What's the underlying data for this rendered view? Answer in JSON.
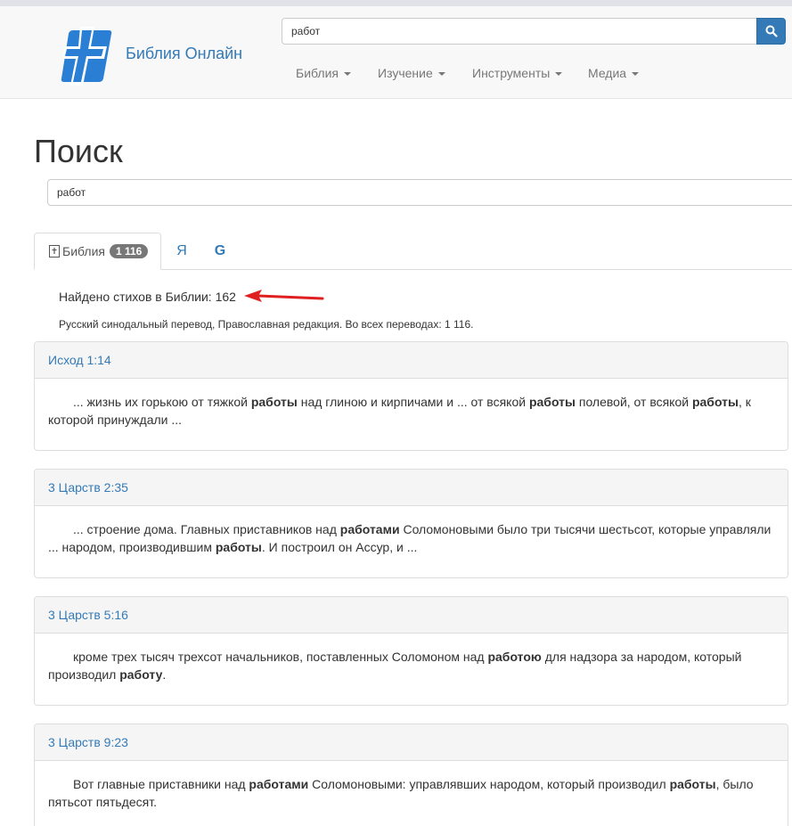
{
  "header": {
    "brand": "Библия Онлайн",
    "search_value": "работ",
    "menu": [
      {
        "label": "Библия"
      },
      {
        "label": "Изучение"
      },
      {
        "label": "Инструменты"
      },
      {
        "label": "Медиа"
      }
    ],
    "accent_color": "#337ab7"
  },
  "page": {
    "title": "Поиск",
    "search_value": "работ"
  },
  "tabs": {
    "bible_label": "Библия",
    "bible_count": "1 116",
    "yandex_label": "Я",
    "google_label": "G"
  },
  "results": {
    "found_text": "Найдено стихов в Библии: 162",
    "translation_note": "Русский синодальный перевод, Православная редакция. Во всех переводах: 1 116.",
    "items": [
      {
        "ref": "Исход 1:14",
        "parts": [
          {
            "t": "... жизнь их горькою от тяжкой "
          },
          {
            "b": "работы"
          },
          {
            "t": " над глиною и кирпичами и ... от всякой "
          },
          {
            "b": "работы"
          },
          {
            "t": " полевой, от всякой "
          },
          {
            "b": "работы"
          },
          {
            "t": ", к которой принуждали ..."
          }
        ]
      },
      {
        "ref": "3 Царств 2:35",
        "parts": [
          {
            "t": "... строение дома. Главных приставников над "
          },
          {
            "b": "работами"
          },
          {
            "t": " Соломоновыми было три тысячи шестьсот, которые управляли ... народом, производившим "
          },
          {
            "b": "работы"
          },
          {
            "t": ". И построил он Ассур, и ..."
          }
        ]
      },
      {
        "ref": "3 Царств 5:16",
        "parts": [
          {
            "t": "кроме трех тысяч трехсот начальников, поставленных Соломоном над "
          },
          {
            "b": "работою"
          },
          {
            "t": " для надзора за народом, который производил "
          },
          {
            "b": "работу"
          },
          {
            "t": "."
          }
        ]
      },
      {
        "ref": "3 Царств 9:23",
        "parts": [
          {
            "t": "Вот главные приставники над "
          },
          {
            "b": "работами"
          },
          {
            "t": " Соломоновыми: управлявших народом, который производил "
          },
          {
            "b": "работы"
          },
          {
            "t": ", было пятьсот пятьдесят."
          }
        ]
      }
    ]
  }
}
